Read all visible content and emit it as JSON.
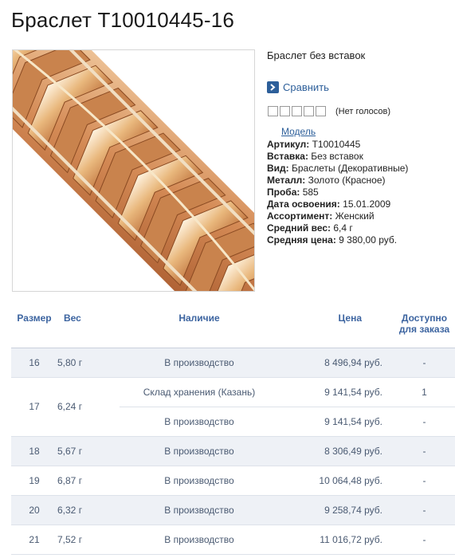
{
  "product": {
    "title": "Браслет Т10010445-16",
    "subtitle": "Браслет без вставок",
    "compare_label": "Сравнить",
    "votes_text": "(Нет голосов)",
    "model_link": "Модель",
    "properties": [
      {
        "label": "Артикул:",
        "value": " Т10010445"
      },
      {
        "label": "Вставка:",
        "value": " Без вставок"
      },
      {
        "label": "Вид:",
        "value": " Браслеты (Декоративные)"
      },
      {
        "label": "Металл:",
        "value": " Золото (Красное)"
      },
      {
        "label": "Проба:",
        "value": " 585"
      },
      {
        "label": "Дата освоения:",
        "value": " 15.01.2009"
      },
      {
        "label": "Ассортимент:",
        "value": " Женский"
      },
      {
        "label": "Средний вес:",
        "value": " 6,4 г"
      },
      {
        "label": "Средняя цена:",
        "value": " 9 380,00 руб."
      }
    ]
  },
  "table": {
    "headers": {
      "size": "Размер",
      "weight": "Вес",
      "stock": "Наличие",
      "price": "Цена",
      "order_line1": "Доступно",
      "order_line2": "для заказа"
    },
    "rows": [
      {
        "size": "16",
        "weight": "5,80 г",
        "stock": "В производство",
        "price": "8 496,94 руб.",
        "order": "-"
      },
      {
        "size": "17",
        "weight": "6,24 г",
        "stock": "Склад хранения (Казань)",
        "price": "9 141,54 руб.",
        "order": "1"
      },
      {
        "size": "",
        "weight": "",
        "stock": "В производство",
        "price": "9 141,54 руб.",
        "order": "-"
      },
      {
        "size": "18",
        "weight": "5,67 г",
        "stock": "В производство",
        "price": "8 306,49 руб.",
        "order": "-"
      },
      {
        "size": "19",
        "weight": "6,87 г",
        "stock": "В производство",
        "price": "10 064,48 руб.",
        "order": "-"
      },
      {
        "size": "20",
        "weight": "6,32 г",
        "stock": "В производство",
        "price": "9 258,74 руб.",
        "order": "-"
      },
      {
        "size": "21",
        "weight": "7,52 г",
        "stock": "В производство",
        "price": "11 016,72 руб.",
        "order": "-"
      }
    ]
  },
  "colors": {
    "link": "#2d5f9a",
    "header_text": "#3c64a0",
    "row_shade": "#eef1f6",
    "gold": "#d9a06b"
  }
}
